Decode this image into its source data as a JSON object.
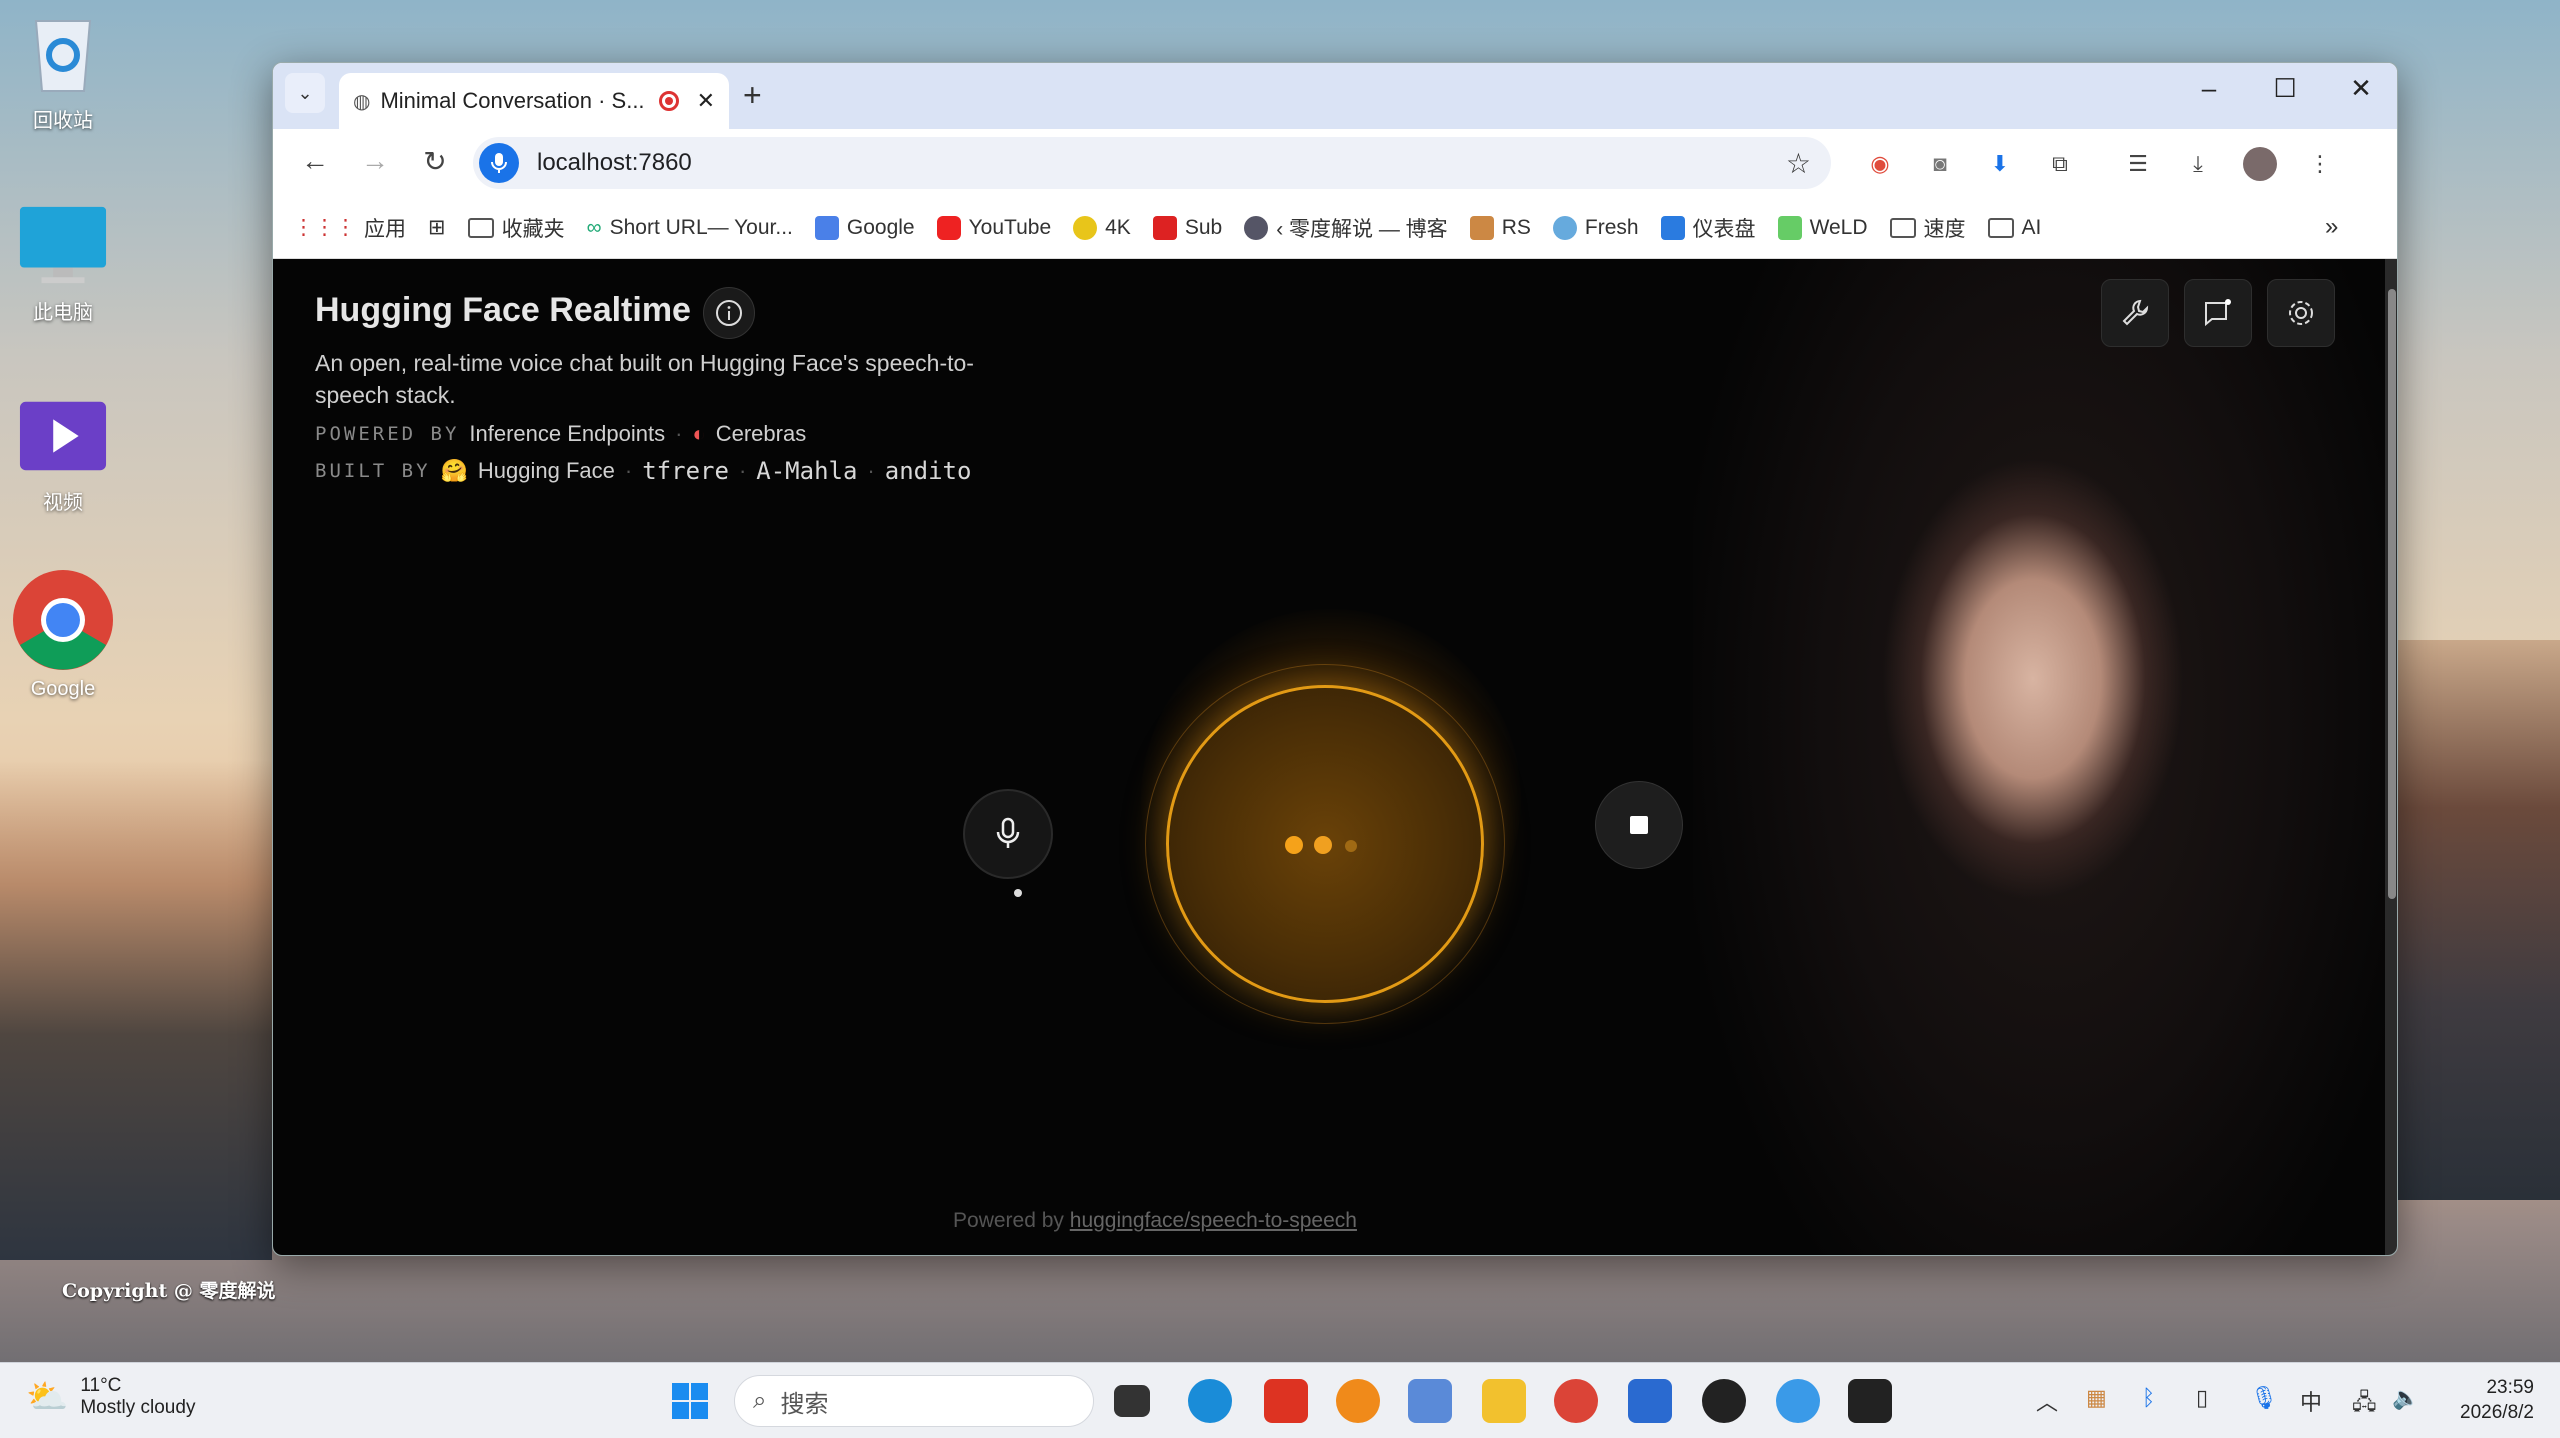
{
  "desktop": {
    "icons": [
      {
        "label": "回收站"
      },
      {
        "label": "此电脑"
      },
      {
        "label": "视频"
      },
      {
        "label": "Google"
      }
    ],
    "copyright": "Copyright @ 零度解说"
  },
  "browser": {
    "tab": {
      "title": "Minimal Conversation · S..."
    },
    "address": "localhost:7860",
    "bookmarks": [
      {
        "label": "应用"
      },
      {
        "label": "收藏夹"
      },
      {
        "label": "Short URL— Your..."
      },
      {
        "label": "Google"
      },
      {
        "label": "YouTube"
      },
      {
        "label": "4K"
      },
      {
        "label": "Sub"
      },
      {
        "label": "‹ 零度解说 — 博客"
      },
      {
        "label": "RS"
      },
      {
        "label": "Fresh"
      },
      {
        "label": "仪表盘"
      },
      {
        "label": "WeLD"
      },
      {
        "label": "速度"
      },
      {
        "label": "AI"
      }
    ]
  },
  "app": {
    "title": "Hugging Face Realtime",
    "description": "An open, real-time voice chat built on Hugging Face's speech-to-speech stack.",
    "powered_by_label": "POWERED BY",
    "powered_by": [
      "Inference Endpoints",
      "Cerebras"
    ],
    "built_by_label": "BUILT BY",
    "built_by": [
      "Hugging Face",
      "tfrere",
      "A-Mahla",
      "andito"
    ],
    "footer_prefix": "Powered by",
    "footer_link": "huggingface/speech-to-speech"
  },
  "taskbar": {
    "weather_temp": "11°C",
    "weather_desc": "Mostly cloudy",
    "search_placeholder": "搜索",
    "ime": "中",
    "time": "23:59",
    "date": "2026/8/2"
  },
  "colors": {
    "accent": "#e29a15",
    "tab_bg": "#dae3f5",
    "page_bg": "#050505"
  }
}
